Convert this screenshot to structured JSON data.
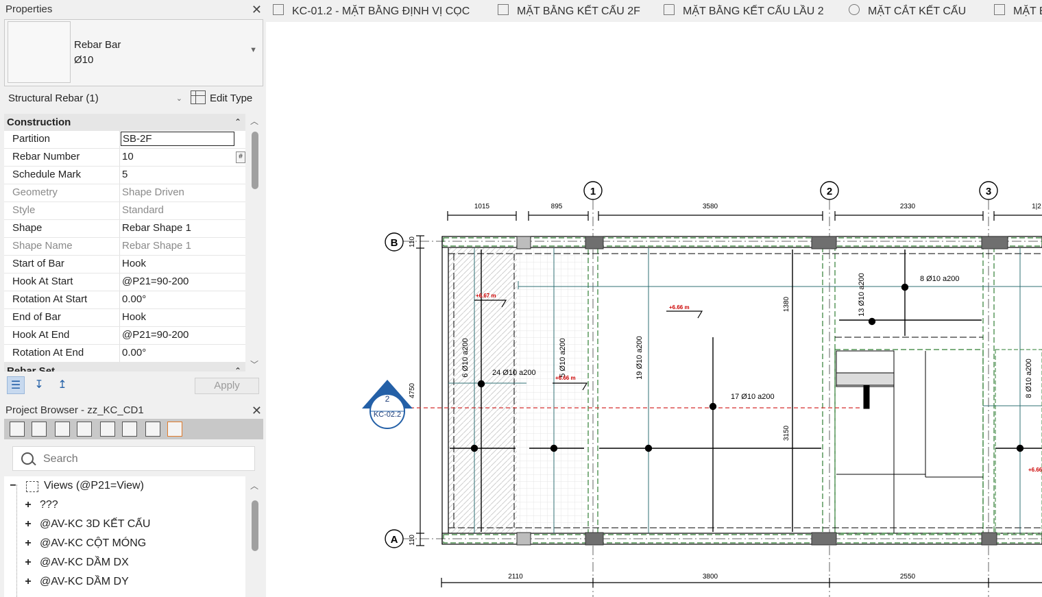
{
  "properties": {
    "title": "Properties",
    "type_name_line1": "Rebar Bar",
    "type_name_line2": "Ø10",
    "selector_label": "Structural Rebar (1)",
    "edit_type_label": "Edit Type",
    "groups": [
      {
        "name": "Construction"
      },
      {
        "name": "Rebar Set"
      }
    ],
    "rows": [
      {
        "key": "Partition",
        "value": "SB-2F"
      },
      {
        "key": "Rebar Number",
        "value": "10"
      },
      {
        "key": "Schedule Mark",
        "value": "5"
      },
      {
        "key": "Geometry",
        "value": "Shape Driven"
      },
      {
        "key": "Style",
        "value": "Standard"
      },
      {
        "key": "Shape",
        "value": "Rebar Shape 1"
      },
      {
        "key": "Shape Name",
        "value": "Rebar Shape 1"
      },
      {
        "key": "Start of Bar",
        "value": "Hook"
      },
      {
        "key": "Hook At Start",
        "value": "@P21=90-200"
      },
      {
        "key": "Rotation At Start",
        "value": "0.00°"
      },
      {
        "key": "End of Bar",
        "value": "Hook"
      },
      {
        "key": "Hook At End",
        "value": "@P21=90-200"
      },
      {
        "key": "Rotation At End",
        "value": "0.00°"
      }
    ],
    "apply_label": "Apply"
  },
  "project_browser": {
    "title": "Project Browser - zz_KC_CD1",
    "search_placeholder": "Search",
    "root": "Views (@P21=View)",
    "items": [
      "???",
      "@AV-KC 3D KẾT CẤU",
      "@AV-KC CỘT MÓNG",
      "@AV-KC DẦM DX",
      "@AV-KC DẦM DY"
    ]
  },
  "tabs": [
    "KC-01.2 - MẶT BẰNG ĐỊNH VỊ CỌC",
    "MẶT BẰNG KẾT CẤU 2F",
    "MẶT BẰNG KẾT CẤU LẦU 2",
    "MẶT CẮT KẾT CẤU",
    "MẶT BẰ"
  ],
  "drawing": {
    "grid_columns": [
      "1",
      "2",
      "3"
    ],
    "grid_rows": [
      "B",
      "A"
    ],
    "top_dims": [
      "1015",
      "895",
      "3580",
      "2330",
      "1|2"
    ],
    "bottom_dims": [
      "2110",
      "3800",
      "2550"
    ],
    "left_dims": [
      "110",
      "4750",
      "110"
    ],
    "inner_dims": [
      "1380",
      "3150"
    ],
    "section_marker": {
      "number": "2",
      "sheet": "KC-02.2"
    },
    "rebar_tags": [
      "6 Ø10 a200",
      "24 Ø10 a200",
      "5 Ø10 a200",
      "19 Ø10 a200",
      "17 Ø10 a200",
      "13 Ø10 a200",
      "8 Ø10 a200",
      "8 Ø10 a200"
    ],
    "level_tags": [
      "+6.67 m",
      "+6.66 m",
      "+6.66 m",
      "+6.66"
    ],
    "colors": {
      "accent": "#2460a7",
      "level": "#cc0000",
      "hatch": "#2e7d32"
    }
  }
}
